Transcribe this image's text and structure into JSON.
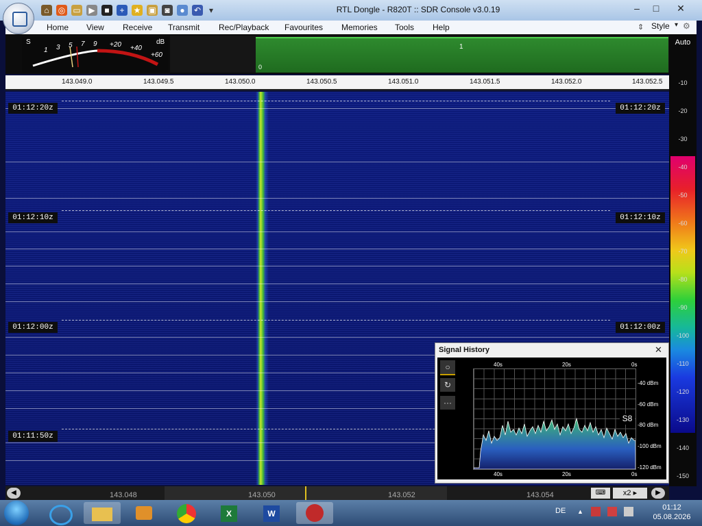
{
  "window": {
    "title": "RTL Dongle - R820T :: SDR Console v3.0.19",
    "style_label": "Style"
  },
  "menu": [
    "Home",
    "View",
    "Receive",
    "Transmit",
    "Rec/Playback",
    "Favourites",
    "Memories",
    "Tools",
    "Help"
  ],
  "smeter": {
    "s_label": "S",
    "db_label": "dB",
    "s_ticks": [
      "1",
      "3",
      "5",
      "7",
      "9"
    ],
    "db_ticks": [
      "+20",
      "+40",
      "+60"
    ]
  },
  "panadapter": {
    "marker": "1",
    "zero": "0"
  },
  "freq_scale": [
    "143.049.0",
    "143.049.5",
    "143.050.0",
    "143.050.5",
    "143.051.0",
    "143.051.5",
    "143.052.0",
    "143.052.5"
  ],
  "timestamps": [
    "01:12:20z",
    "01:12:10z",
    "01:12:00z",
    "01:11:50z"
  ],
  "db_scale": {
    "auto": "Auto",
    "levels": [
      "-10",
      "-20",
      "-30",
      "-40",
      "-50",
      "-60",
      "-70",
      "-80",
      "-90",
      "-100",
      "-110",
      "-120",
      "-130",
      "-140",
      "-150"
    ]
  },
  "bottom": {
    "freqs": [
      "143.048",
      "143.050",
      "143.052",
      "143.054"
    ],
    "zoom": "x2"
  },
  "signal_history": {
    "title": "Signal History",
    "close": "✕",
    "top_time": [
      "40s",
      "20s",
      "0s"
    ],
    "bottom_time": [
      "40s",
      "20s",
      "0s"
    ],
    "dbm": [
      "-40 dBm",
      "-60 dBm",
      "-80 dBm",
      "-100 dBm",
      "-120 dBm"
    ],
    "s_reading": "S8",
    "buttons": [
      "○",
      "↻",
      "···"
    ]
  },
  "taskbar": {
    "lang": "DE",
    "time": "01:12",
    "date": "05.08.2026"
  }
}
